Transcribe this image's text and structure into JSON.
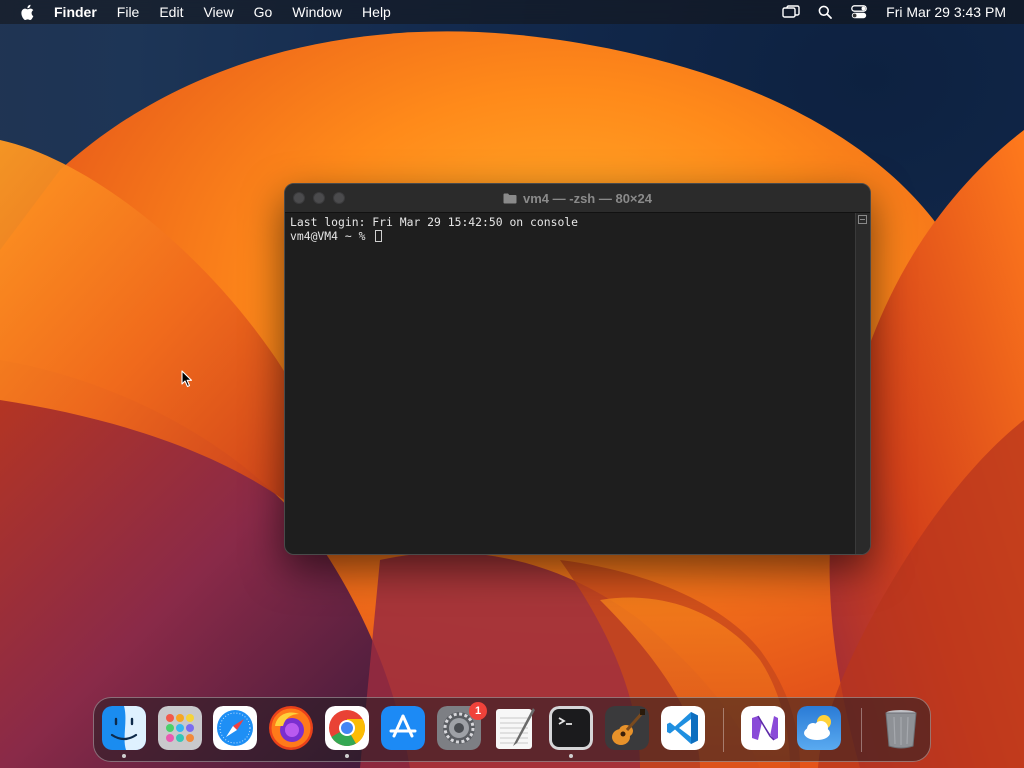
{
  "menubar": {
    "app_name": "Finder",
    "menus": [
      "File",
      "Edit",
      "View",
      "Go",
      "Window",
      "Help"
    ],
    "clock": "Fri Mar 29  3:43 PM",
    "status_icons": [
      "screen-mirroring-icon",
      "search-icon",
      "control-center-icon"
    ]
  },
  "terminal": {
    "title": "vm4 — -zsh — 80×24",
    "lines": [
      "Last login: Fri Mar 29 15:42:50 on console",
      "vm4@VM4 ~ % "
    ]
  },
  "dock": {
    "items": [
      {
        "name": "finder",
        "running": true
      },
      {
        "name": "launchpad",
        "running": false
      },
      {
        "name": "safari",
        "running": false
      },
      {
        "name": "firefox",
        "running": false
      },
      {
        "name": "chrome",
        "running": true
      },
      {
        "name": "app-store",
        "running": false
      },
      {
        "name": "system-settings",
        "running": false,
        "badge": "1"
      },
      {
        "name": "textedit",
        "running": false
      },
      {
        "name": "terminal",
        "running": true
      },
      {
        "name": "garageband",
        "running": false
      },
      {
        "name": "vscode",
        "running": false
      },
      {
        "name": "visual-studio",
        "running": false
      },
      {
        "name": "weather",
        "running": false
      },
      {
        "name": "trash",
        "running": false
      }
    ]
  },
  "colors": {
    "wallpaper_orange": "#f47a1c",
    "wallpaper_red": "#c8331c",
    "wallpaper_magenta": "#8a2a4a",
    "terminal_bg": "#1e1e1e",
    "badge_red": "#f0423a"
  }
}
